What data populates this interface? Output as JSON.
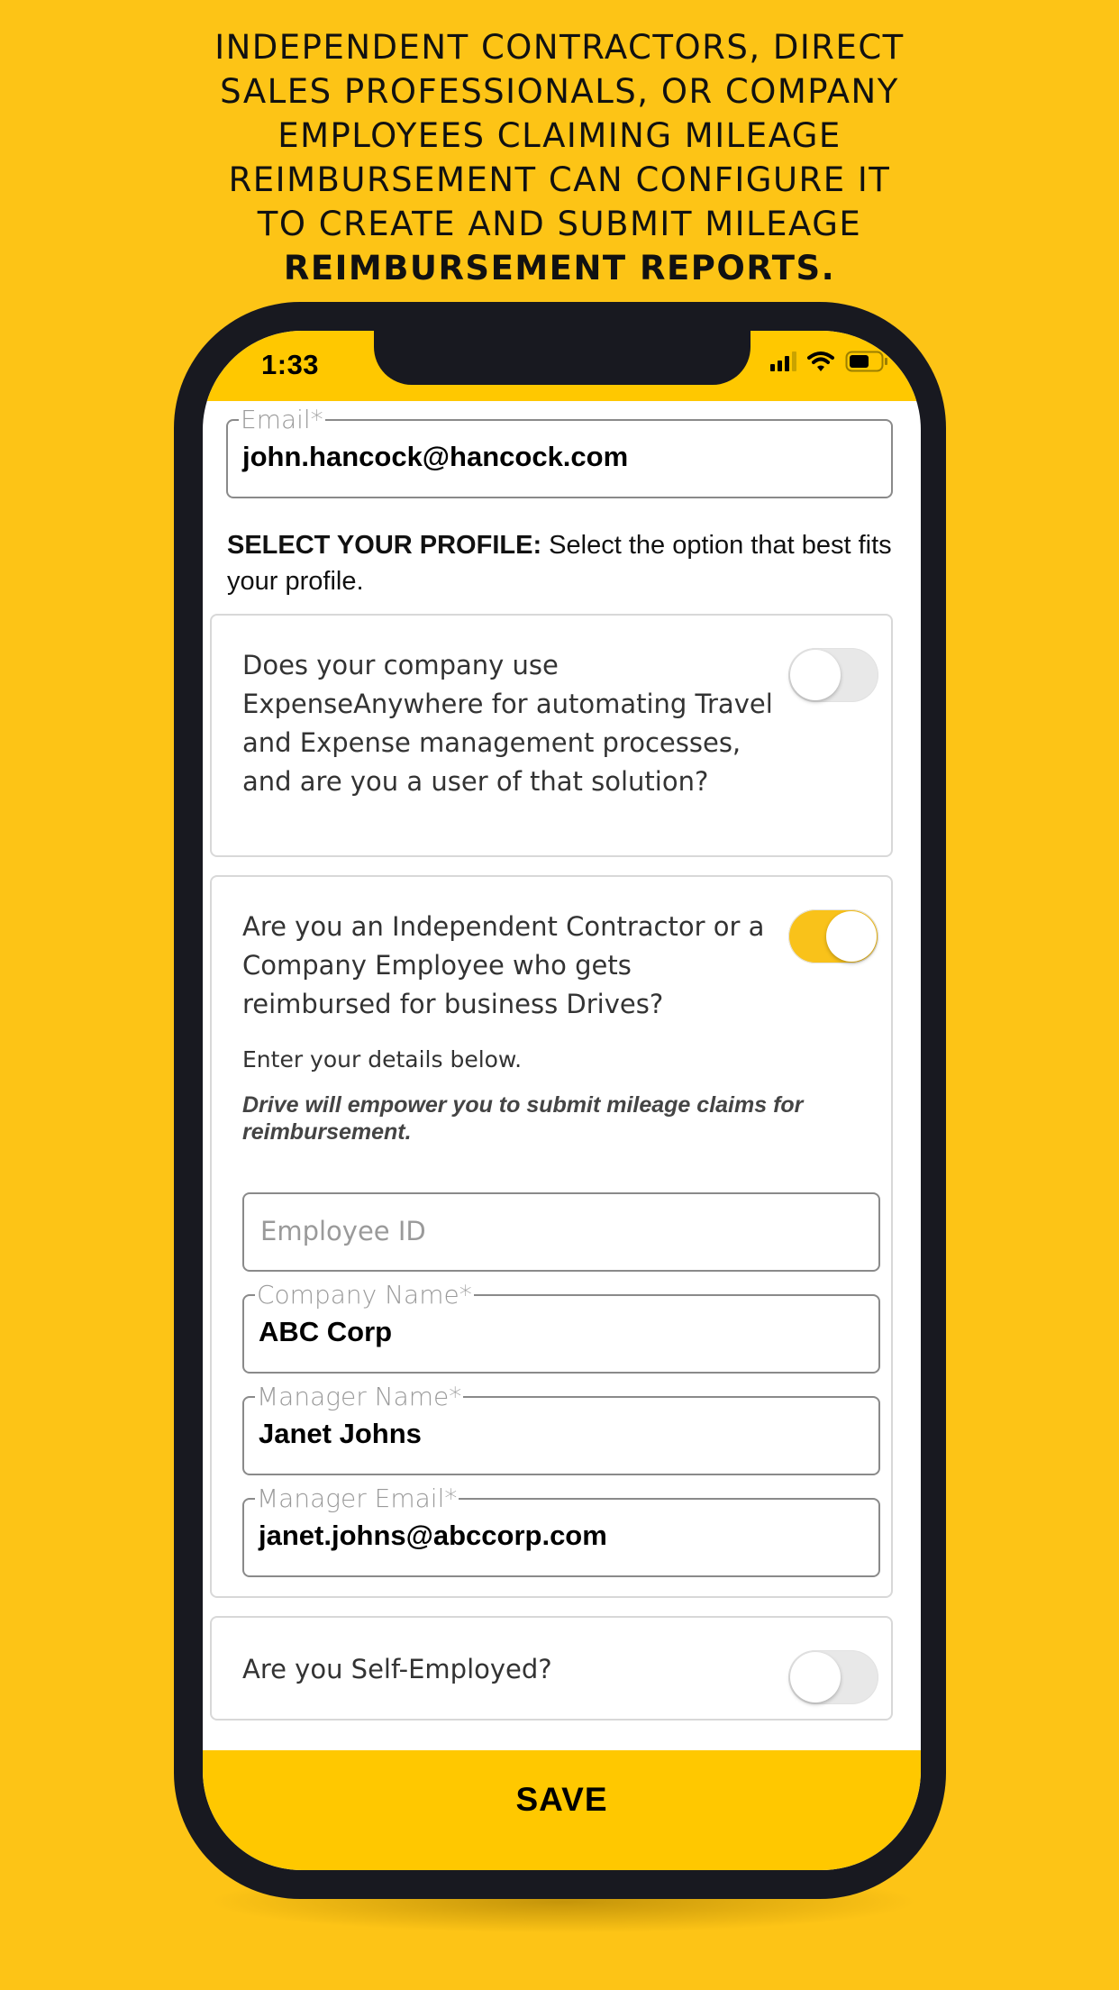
{
  "headline": {
    "lines": [
      "INDEPENDENT CONTRACTORS, DIRECT",
      "SALES PROFESSIONALS, OR COMPANY",
      "EMPLOYEES CLAIMING MILEAGE",
      "REIMBURSEMENT CAN CONFIGURE IT",
      "TO CREATE AND SUBMIT MILEAGE"
    ],
    "bold_line": "REIMBURSEMENT REPORTS."
  },
  "status_bar": {
    "time": "1:33",
    "icons": [
      "signal-icon",
      "wifi-icon",
      "battery-icon"
    ],
    "signal_bars_active": 3,
    "signal_bars_total": 4,
    "battery_level": 0.6
  },
  "form": {
    "email": {
      "label": "Email*",
      "value": "john.hancock@hancock.com"
    },
    "profile_heading_bold": "SELECT YOUR PROFILE:",
    "profile_heading_text": " Select the option that best fits your profile.",
    "options": [
      {
        "question": "Does your company use ExpenseAnywhere for automating Travel and Expense management processes, and are you a user of that solution?",
        "enabled": false
      },
      {
        "question": "Are you an Independent Contractor or a Company Employee who gets reimbursed for business Drives?",
        "enabled": true,
        "subtext": "Enter your details below.",
        "note": "Drive will empower you to submit mileage claims for reimbursement.",
        "fields": {
          "employee_id": {
            "placeholder": "Employee ID",
            "value": ""
          },
          "company_name": {
            "label": "Company Name*",
            "value": "ABC Corp"
          },
          "manager_name": {
            "label": "Manager Name*",
            "value": "Janet Johns"
          },
          "manager_email": {
            "label": "Manager Email*",
            "value": "janet.johns@abccorp.com"
          }
        }
      },
      {
        "question": "Are you Self-Employed?",
        "enabled": false
      }
    ],
    "save_label": "SAVE"
  },
  "colors": {
    "background": "#FDC416",
    "accent": "#FFC800",
    "toggle_on": "#F9C21A",
    "phone_frame": "#181920"
  }
}
